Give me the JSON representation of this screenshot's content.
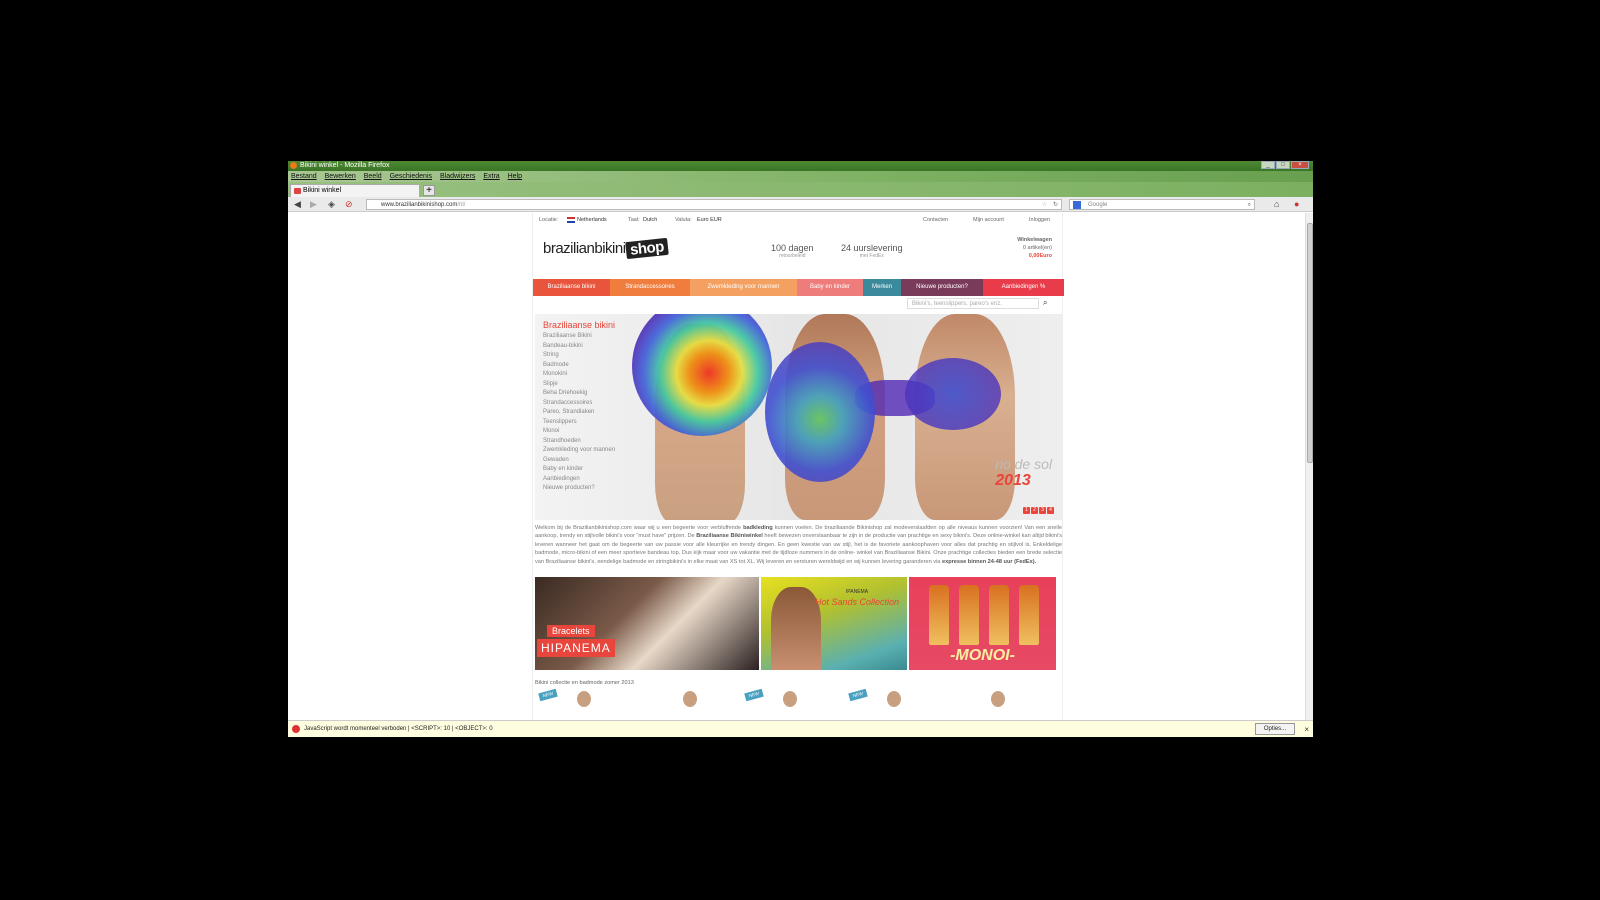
{
  "window": {
    "title": "Bikini winkel - Mozilla Firefox"
  },
  "menubar": [
    "Bestand",
    "Bewerken",
    "Beeld",
    "Geschiedenis",
    "Bladwijzers",
    "Extra",
    "Help"
  ],
  "tab": {
    "title": "Bikini winkel",
    "new_tab": "+"
  },
  "nav": {
    "back": "◀",
    "forward": "▶",
    "url_host": "www.brazilianbikinishop.com",
    "url_path": "/nl/",
    "search_placeholder": "Google"
  },
  "site": {
    "topline": {
      "locatie": "Locatie:",
      "country": "Netherlands",
      "taal": "Taal:",
      "lang": "Dutch",
      "valuta": "Valuta:",
      "cur": "Euro EUR",
      "contacten": "Contacten",
      "account": "Mijn account",
      "login": "Inloggen"
    },
    "logo": {
      "text": "brazilianbikini",
      "tag": "shop"
    },
    "usp1": {
      "big": "100 dagen",
      "small": "retourbeleid"
    },
    "usp2": {
      "big": "24 uurslevering",
      "small": "met FedEx"
    },
    "cart": {
      "label": "Winkelwagen",
      "items": "0 artikel(en)",
      "price": "0,00Euro"
    },
    "categories": [
      {
        "label": "Braziliaanse bikini",
        "color": "#e8543c"
      },
      {
        "label": "Strandaccessoires",
        "color": "#f07c3e"
      },
      {
        "label": "Zwemkleding voor mannen",
        "color": "#f3a060"
      },
      {
        "label": "Baby en kinder",
        "color": "#ee7c7a"
      },
      {
        "label": "Merken",
        "color": "#3b8a9c"
      },
      {
        "label": "Nieuwe producten?",
        "color": "#7a3a5a"
      },
      {
        "label": "Aanbiedingen %",
        "color": "#e83c4a"
      }
    ],
    "site_search_placeholder": "Bikini's, teenslippers, pareo's enz.",
    "sidebar": {
      "heading": "Braziliaanse bikini",
      "items": [
        "Braziliaanse Bikini",
        "Bandeau-bikini",
        "String",
        "Badmode",
        "Monokini",
        "Slipje",
        "Beha Driehoekig",
        "Strandaccessoires",
        "Pareo, Strandlaken",
        "Teenslippers",
        "Monoi",
        "Strandhoeden",
        "Zwemkleding voor mannen",
        "Gewaden",
        "Baby en kinder",
        "Aanbiedingen",
        "Nieuwe producten?"
      ]
    },
    "hero": {
      "brand": "rio de sol",
      "year": "2013",
      "pages": [
        "1",
        "2",
        "3",
        "4"
      ]
    },
    "intro": {
      "p1": "Welkom bij de Brazilianbikinishop.com waar wij u een begeerte voor verbluffende ",
      "b1": "badkleding",
      "p2": " kunnen voelen. De braziliaande Bikinishop zal modeverslaafden op alle niveaus kunnen voorzien! Van een snelle aankoop, trendy en stijlvolle bikini's voor \"must have\" prijzen. De ",
      "b2": "Braziliaanse Bikiniwinkel",
      "p3": " heeft bewezen onverslaanbaar te zijn in de productie van prachtige en sexy bikini's. Deze online-winkel kan altijd bikini's leveren wanneer het gaat om de begeerte van uw passie voor alle kleurrijke en trendy dingen. En geen kwestie van uw stijl, het is de favoriete aankoophaven voor alles dat prachtig en stijlvol is. Enkeldelige badmode, micro-bikini of een meer sportieve bandeau top. Dus kijk maar voor uw vakantie met de tijdloze nummers in de online- winkel van Braziliaanse Bikini. Onze prachtige collecties bieden een brede selectie van Braziliaanse bikini's, eendelige badmode en stringbikini's in elke maat van XS tot XL. Wij leveren en versturen wereldwijd en wij kunnen levering garanderen via ",
      "b3": "expresse binnen 24-48 uur (FedEx)."
    },
    "banners": {
      "b1_label": "Bracelets",
      "b1_brand": "HIPANEMA",
      "b2_brand": "IPANEMA",
      "b2_title": "Hot Sands Collection",
      "b3_brand": "-MONOI-"
    },
    "collection_title": "Bikini collectie en badmode zomer 2013",
    "new_badge": "NEW"
  },
  "statusbar": {
    "message": "JavaScript wordt momenteel verboden | <SCRIPT>: 10 | <OBJECT>: 0",
    "options": "Opties...",
    "close": "×"
  }
}
